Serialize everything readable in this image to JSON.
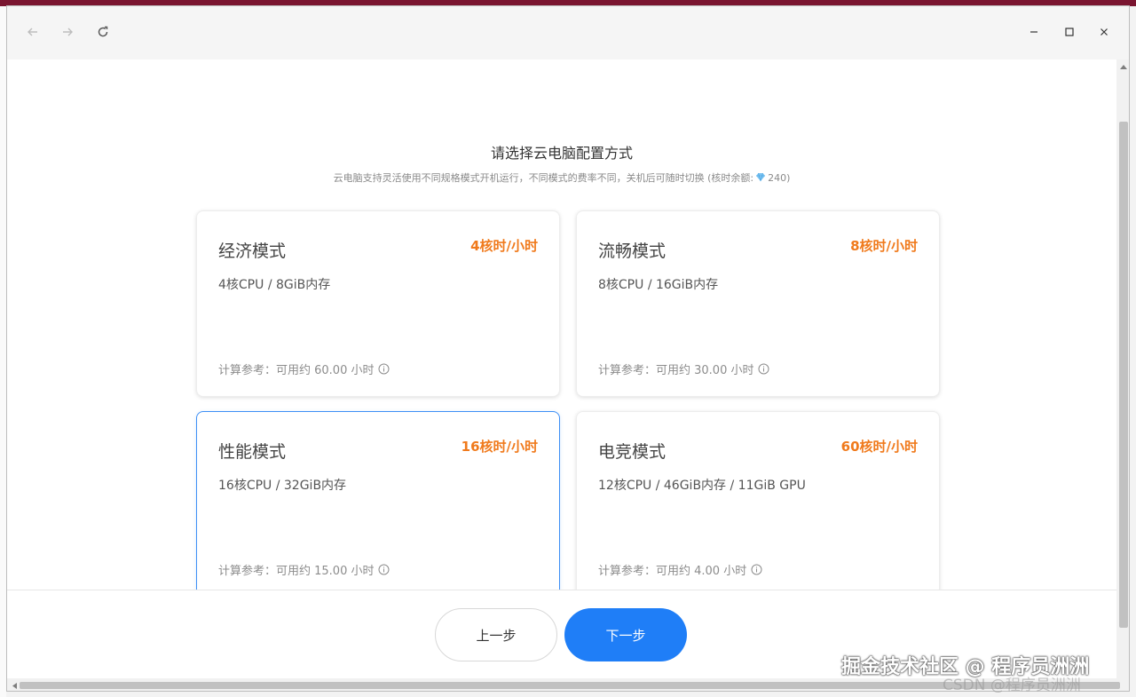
{
  "window": {
    "nav": {
      "back_icon": "arrow-left-icon",
      "forward_icon": "arrow-right-icon",
      "refresh_icon": "refresh-icon"
    },
    "controls": {
      "minimize_icon": "minimize-icon",
      "maximize_icon": "maximize-icon",
      "close_icon": "close-icon"
    }
  },
  "header": {
    "title": "请选择云电脑配置方式",
    "subtitle_prefix": "云电脑支持灵活使用不同规格模式开机运行，不同模式的费率不同，关机后可随时切换 (核时余额:",
    "balance": "240",
    "subtitle_suffix": ")"
  },
  "modes": [
    {
      "name": "经济模式",
      "rate": "4核时/小时",
      "spec": "4核CPU / 8GiB内存",
      "reference": "计算参考：可用约 60.00 小时",
      "selected": false
    },
    {
      "name": "流畅模式",
      "rate": "8核时/小时",
      "spec": "8核CPU / 16GiB内存",
      "reference": "计算参考：可用约 30.00 小时",
      "selected": false
    },
    {
      "name": "性能模式",
      "rate": "16核时/小时",
      "spec": "16核CPU / 32GiB内存",
      "reference": "计算参考：可用约 15.00 小时",
      "selected": true
    },
    {
      "name": "电竞模式",
      "rate": "60核时/小时",
      "spec": "12核CPU / 46GiB内存 / 11GiB GPU",
      "reference": "计算参考：可用约 4.00 小时",
      "selected": false
    }
  ],
  "footer": {
    "prev_label": "上一步",
    "next_label": "下一步"
  },
  "watermark": {
    "text": "掘金技术社区 @ 程序员洲洲",
    "secondary": "CSDN @程序员洲洲"
  },
  "colors": {
    "accent": "#1f7ef7",
    "rate": "#f07a1c",
    "titlebar_accent": "#7a1530"
  }
}
